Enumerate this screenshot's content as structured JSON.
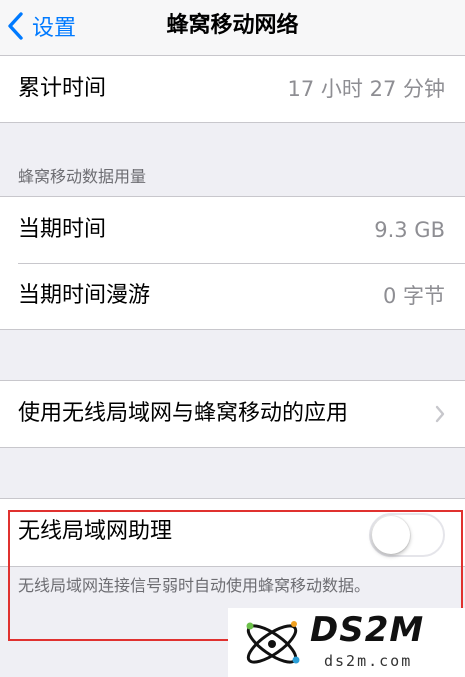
{
  "navbar": {
    "back_label": "设置",
    "title": "蜂窝移动网络"
  },
  "usage_time": {
    "label": "累计时间",
    "value": "17 小时 27 分钟"
  },
  "cellular_data": {
    "header": "蜂窝移动数据用量",
    "rows": [
      {
        "label": "当期时间",
        "value": "9.3 GB"
      },
      {
        "label": "当期时间漫游",
        "value": "0 字节"
      }
    ]
  },
  "apps_row": {
    "label": "使用无线局域网与蜂窝移动的应用"
  },
  "wifi_assist": {
    "label": "无线局域网助理",
    "toggle_on": false,
    "description": "无线局域网连接信号弱时自动使用蜂窝移动数据。"
  },
  "watermark": {
    "brand": "DS2M",
    "site": "ds2m.com"
  },
  "colors": {
    "accent": "#007aff",
    "highlight": "#e0312f",
    "background": "#efeff4"
  }
}
